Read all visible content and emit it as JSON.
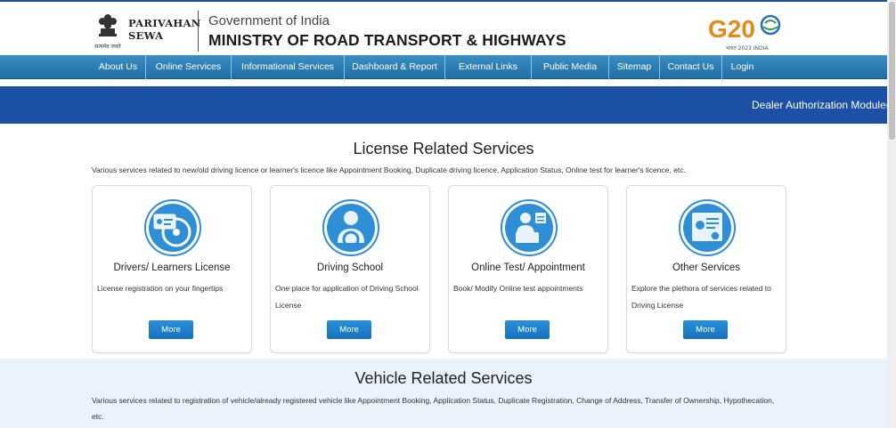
{
  "header": {
    "brand_line1": "PARIVAHAN",
    "brand_line2": "SEWA",
    "emblem_motto": "सत्यमेव जयते",
    "gov_label": "Government of India",
    "ministry_label": "MINISTRY OF ROAD TRANSPORT & HIGHWAYS",
    "g20_label": "G20",
    "g20_sub": "भारत 2023 INDIA"
  },
  "nav": {
    "items": [
      {
        "label": "About Us"
      },
      {
        "label": "Online Services"
      },
      {
        "label": "Informational Services"
      },
      {
        "label": "Dashboard & Report"
      },
      {
        "label": "External Links"
      },
      {
        "label": "Public Media"
      },
      {
        "label": "Sitemap"
      },
      {
        "label": "Contact Us"
      },
      {
        "label": "Login"
      }
    ]
  },
  "ticker": {
    "text": "Dealer Authorization Module(C"
  },
  "license": {
    "title": "License Related Services",
    "description": "Various services related to new/old driving licence or learner's licence like Appointment Booking, Duplicate driving licence, Application Status, Online test for learner's licence, etc.",
    "cards": [
      {
        "title": "Drivers/ Learners License",
        "desc": "License registration on your fingertips",
        "button": "More",
        "icon": "license-steering-icon"
      },
      {
        "title": "Driving School",
        "desc": "One place for application of Driving School License",
        "button": "More",
        "icon": "driving-school-icon"
      },
      {
        "title": "Online Test/ Appointment",
        "desc": "Book/ Modify Online test appointments",
        "button": "More",
        "icon": "online-test-icon"
      },
      {
        "title": "Other Services",
        "desc": "Explore the plethora of services related to Driving License",
        "button": "More",
        "icon": "certificate-icon"
      }
    ]
  },
  "vehicle": {
    "title": "Vehicle Related Services",
    "description": "Various services related to registration of vehicle/already registered vehicle like Appointment Booking, Application Status, Duplicate Registration, Change of Address, Transfer of Ownership, Hypothecation, etc."
  },
  "colors": {
    "nav": "#2a7fb8",
    "ticker": "#1c4fa6",
    "button": "#1f80cc",
    "icon_bg": "#2e8fd6"
  }
}
